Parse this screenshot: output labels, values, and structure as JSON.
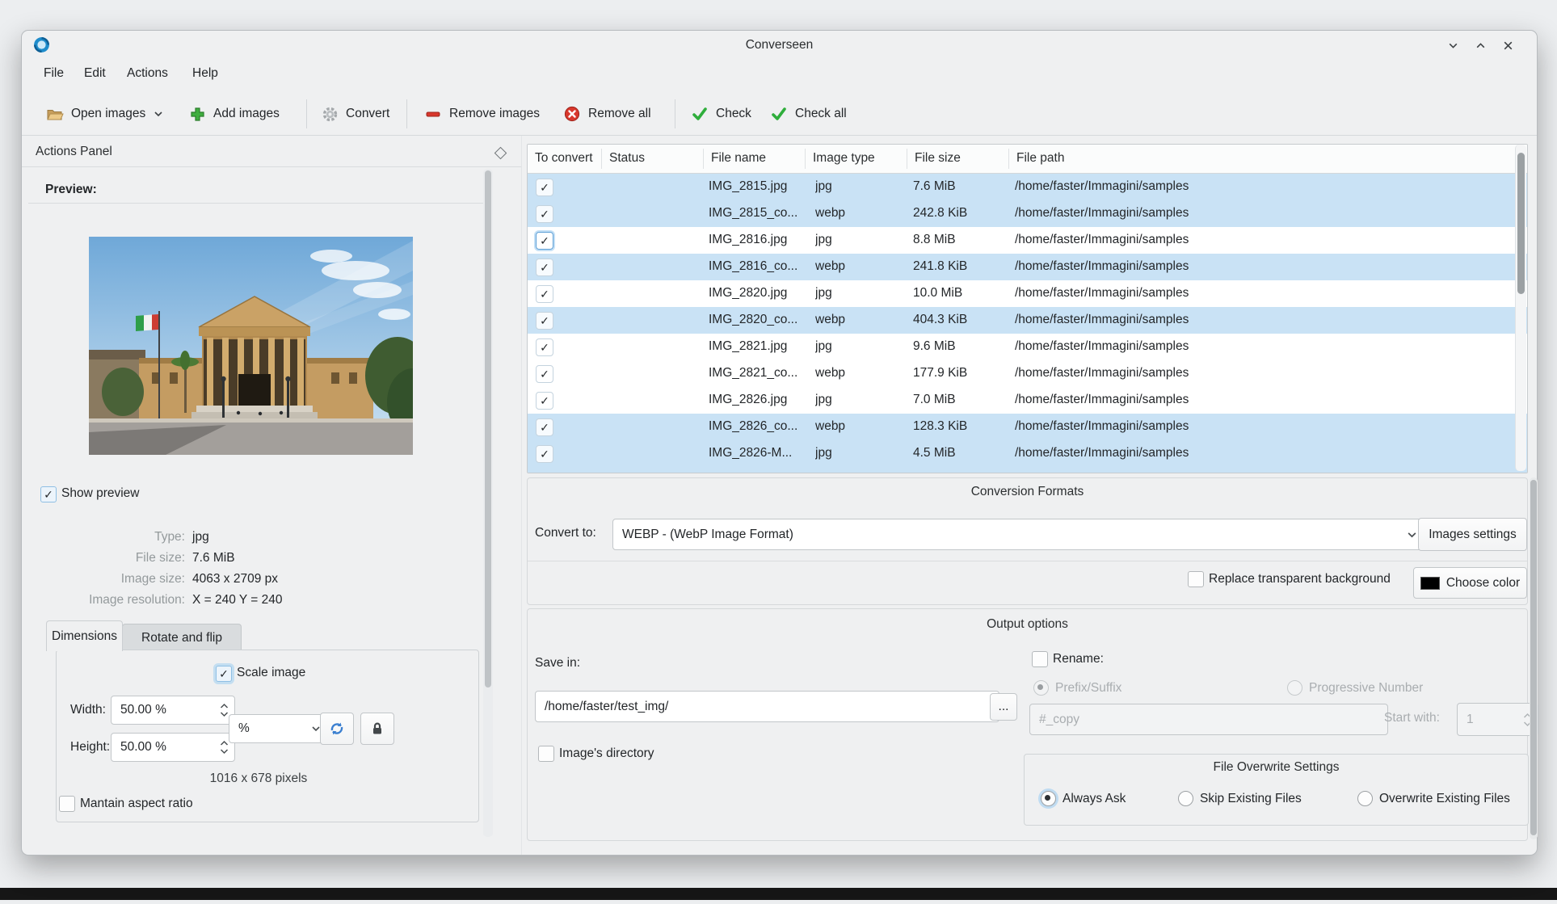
{
  "window": {
    "title": "Converseen"
  },
  "menu": {
    "items": [
      "File",
      "Edit",
      "Actions",
      "Help"
    ]
  },
  "toolbar": {
    "open_images": "Open images",
    "add_images": "Add images",
    "convert": "Convert",
    "remove_images": "Remove images",
    "remove_all": "Remove all",
    "check": "Check",
    "check_all": "Check all"
  },
  "panel": {
    "title": "Actions Panel",
    "preview_label": "Preview:",
    "show_preview": "Show preview",
    "info": {
      "type_label": "Type:",
      "type": "jpg",
      "file_size_label": "File size:",
      "file_size": "7.6 MiB",
      "image_size_label": "Image size:",
      "image_size": "4063 x 2709 px",
      "resolution_label": "Image resolution:",
      "resolution": "X = 240 Y = 240"
    },
    "tabs": [
      "Dimensions",
      "Rotate and flip"
    ],
    "scale": {
      "scale_image": "Scale image",
      "width_label": "Width:",
      "width_value": "50.00 %",
      "height_label": "Height:",
      "height_value": "50.00 %",
      "unit": "%",
      "pixels": "1016 x 678 pixels",
      "maintain": "Mantain aspect ratio"
    }
  },
  "table": {
    "columns": [
      "To convert",
      "Status",
      "File name",
      "Image type",
      "File size",
      "File path"
    ],
    "rows": [
      {
        "name": "IMG_2815.jpg",
        "type": "jpg",
        "size": "7.6 MiB",
        "path": "/home/faster/Immagini/samples",
        "selected": true
      },
      {
        "name": "IMG_2815_co...",
        "type": "webp",
        "size": "242.8 KiB",
        "path": "/home/faster/Immagini/samples",
        "selected": true
      },
      {
        "name": "IMG_2816.jpg",
        "type": "jpg",
        "size": "8.8 MiB",
        "path": "/home/faster/Immagini/samples",
        "selected": false
      },
      {
        "name": "IMG_2816_co...",
        "type": "webp",
        "size": "241.8 KiB",
        "path": "/home/faster/Immagini/samples",
        "selected": true
      },
      {
        "name": "IMG_2820.jpg",
        "type": "jpg",
        "size": "10.0 MiB",
        "path": "/home/faster/Immagini/samples",
        "selected": false
      },
      {
        "name": "IMG_2820_co...",
        "type": "webp",
        "size": "404.3 KiB",
        "path": "/home/faster/Immagini/samples",
        "selected": true
      },
      {
        "name": "IMG_2821.jpg",
        "type": "jpg",
        "size": "9.6 MiB",
        "path": "/home/faster/Immagini/samples",
        "selected": false
      },
      {
        "name": "IMG_2821_co...",
        "type": "webp",
        "size": "177.9 KiB",
        "path": "/home/faster/Immagini/samples",
        "selected": false
      },
      {
        "name": "IMG_2826.jpg",
        "type": "jpg",
        "size": "7.0 MiB",
        "path": "/home/faster/Immagini/samples",
        "selected": false
      },
      {
        "name": "IMG_2826_co...",
        "type": "webp",
        "size": "128.3 KiB",
        "path": "/home/faster/Immagini/samples",
        "selected": true
      },
      {
        "name": "IMG_2826-M...",
        "type": "jpg",
        "size": "4.5 MiB",
        "path": "/home/faster/Immagini/samples",
        "selected": true
      }
    ]
  },
  "conversion": {
    "title": "Conversion Formats",
    "convert_to_label": "Convert to:",
    "format": "WEBP - (WebP Image Format)",
    "images_settings": "Images settings",
    "replace_bg": "Replace transparent background",
    "choose_color": "Choose color",
    "swatch_color": "#000000"
  },
  "output": {
    "title": "Output options",
    "save_in_label": "Save in:",
    "save_path": "/home/faster/test_img/",
    "browse": "...",
    "images_dir": "Image's directory",
    "rename": "Rename:",
    "prefix_suffix": "Prefix/Suffix",
    "progressive": "Progressive Number",
    "rename_pattern": "#_copy",
    "start_with_label": "Start with:",
    "start_with": "1",
    "overwrite": {
      "title": "File Overwrite Settings",
      "options": [
        "Always Ask",
        "Skip Existing Files",
        "Overwrite Existing Files"
      ],
      "selected": "Always Ask"
    }
  }
}
